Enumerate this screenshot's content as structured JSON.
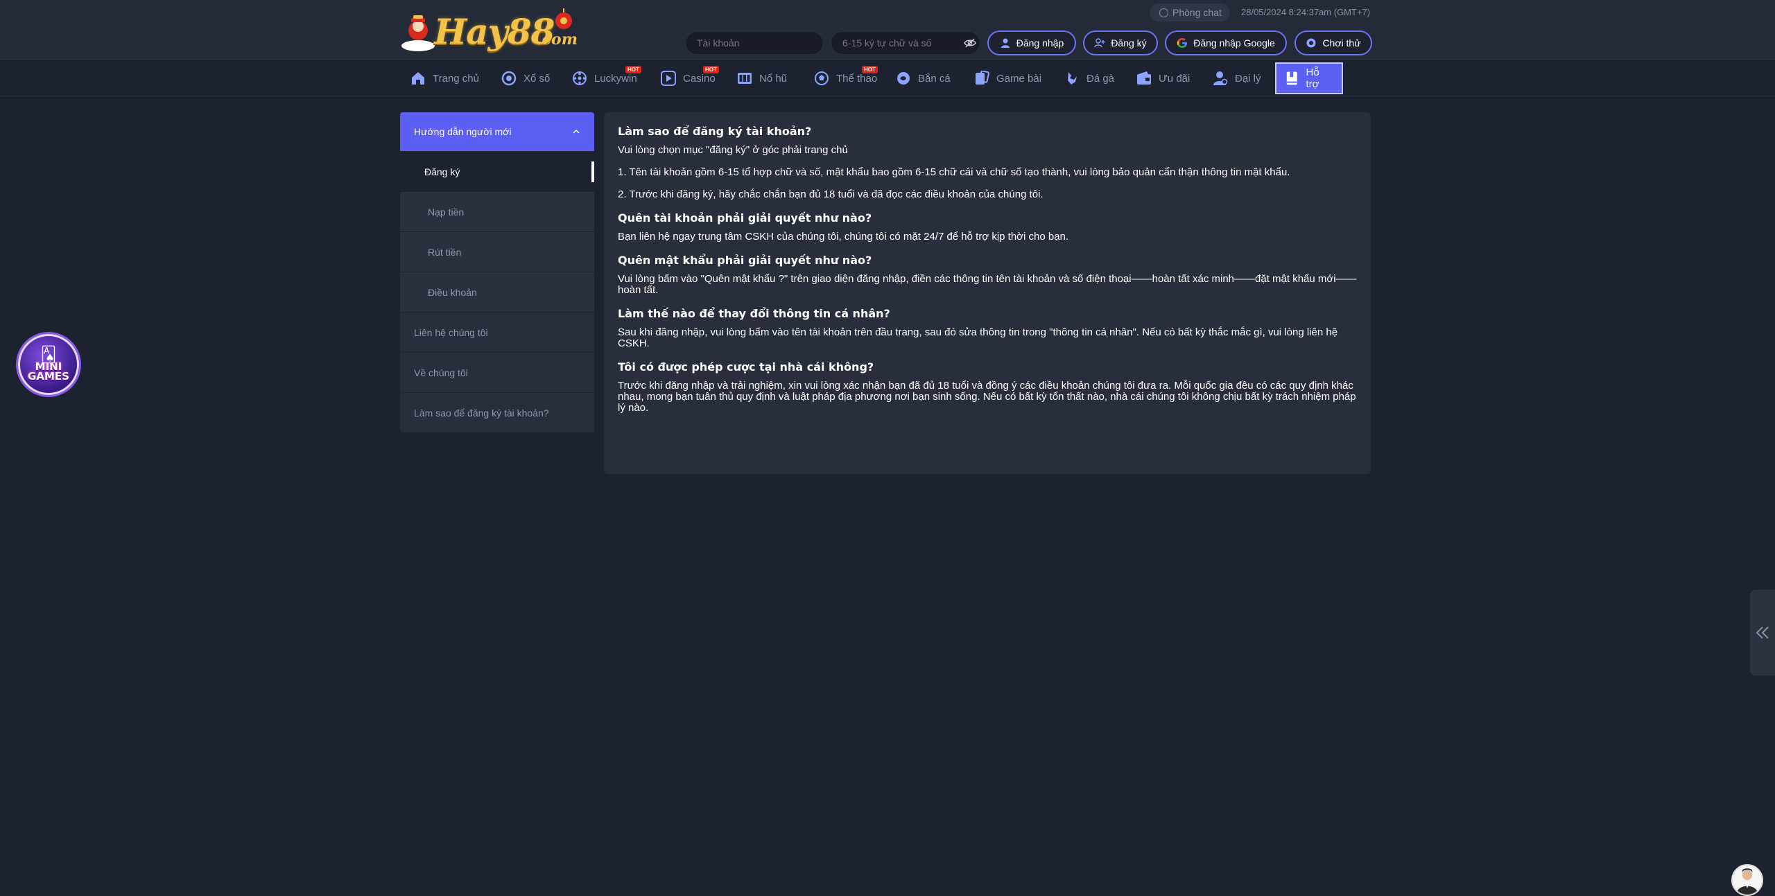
{
  "brand": {
    "logo_text": "Hay88",
    "logo_suffix": ".com"
  },
  "header": {
    "chat_label": "Phòng chat",
    "datetime": "28/05/2024 8:24:37am",
    "timezone": "(GMT+7)",
    "username_placeholder": "Tài khoản",
    "password_placeholder": "6-15 ký tự chữ và số",
    "login_label": "Đăng nhập",
    "register_label": "Đăng ký",
    "google_label": "Đăng nhập Google",
    "try_label": "Chơi thử"
  },
  "nav": {
    "items": [
      {
        "label": "Trang chủ",
        "icon": "home-icon",
        "hot": false
      },
      {
        "label": "Xổ số",
        "icon": "lottery-icon",
        "hot": false
      },
      {
        "label": "Luckywin",
        "icon": "wheel-icon",
        "hot": true
      },
      {
        "label": "Casino",
        "icon": "play-icon",
        "hot": true
      },
      {
        "label": "Nổ hũ",
        "icon": "slot-icon",
        "hot": false
      },
      {
        "label": "Thể thao",
        "icon": "soccer-icon",
        "hot": true
      },
      {
        "label": "Bắn cá",
        "icon": "fish-icon",
        "hot": false
      },
      {
        "label": "Game bài",
        "icon": "cards-icon",
        "hot": false
      },
      {
        "label": "Đá gà",
        "icon": "rooster-icon",
        "hot": false
      },
      {
        "label": "Ưu đãi",
        "icon": "gift-icon",
        "hot": false
      },
      {
        "label": "Đại lý",
        "icon": "agent-icon",
        "hot": false
      },
      {
        "label": "Hỗ trợ",
        "icon": "book-icon",
        "hot": false,
        "active": true
      }
    ],
    "hot_label": "HOT"
  },
  "sidebar": {
    "section_title": "Hướng dẫn người mới",
    "sub_items": [
      "Đăng ký",
      "Nạp tiền",
      "Rút tiền",
      "Điều khoản"
    ],
    "items": [
      "Liên hệ chúng tôi",
      "Về chúng tôi",
      "Làm sao để đăng ký tài khoản?"
    ]
  },
  "content": {
    "q1": "Làm sao để đăng ký tài khoản?",
    "a1_1": "Vui lòng chọn mục \"đăng ký\" ở góc phải trang chủ",
    "a1_2": "1. Tên tài khoản gồm 6-15 tổ hợp chữ và số, mật khẩu bao gồm 6-15 chữ cái và chữ số tạo thành, vui lòng bảo quản cẩn thận thông tin mật khẩu.",
    "a1_3": "2. Trước khi đăng ký, hãy chắc chắn bạn đủ 18 tuổi và đã đọc các điều khoản của chúng tôi.",
    "q2": "Quên tài khoản phải giải quyết như nào?",
    "a2": "Bạn liên hệ ngay trung tâm CSKH của chúng tôi, chúng tôi có mặt 24/7 để hỗ trợ kịp thời cho bạn.",
    "q3": "Quên mật khẩu phải giải quyết như nào?",
    "a3": "Vui lòng bấm vào \"Quên mật khẩu ?\" trên giao diện đăng nhập, điền các thông tin tên tài khoản và số điện thoại——hoàn tất xác minh——đặt mật khẩu mới——hoàn tất.",
    "q4": "Làm thế nào để thay đổi thông tin cá nhân?",
    "a4": "Sau khi đăng nhập, vui lòng bấm vào tên tài khoản trên đầu trang, sau đó sửa thông tin trong \"thông tin cá nhân\". Nếu có bất kỳ thắc mắc gì, vui lòng liên hệ CSKH.",
    "q5": "Tôi có được phép cược tại nhà cái không?",
    "a5": "Trước khi đăng nhập và trải nghiệm, xin vui lòng xác nhận bạn đã đủ 18 tuổi và đồng ý các điều khoản chúng tôi đưa ra. Mỗi quốc gia đều có các quy định khác nhau, mong bạn tuân thủ quy định và luật pháp địa phương nơi bạn sinh sống. Nếu có bất kỳ tổn thất nào, nhà cái chúng tôi không chịu bất kỳ trách nhiệm pháp lý nào."
  },
  "floating": {
    "mini_games_line1": "MINI",
    "mini_games_line2": "GAMES"
  },
  "colors": {
    "accent": "#5b5ff2",
    "background": "#1d2230",
    "panel": "#282e3b",
    "hot": "#e2231a",
    "logo_gold": "#f3c24a"
  }
}
